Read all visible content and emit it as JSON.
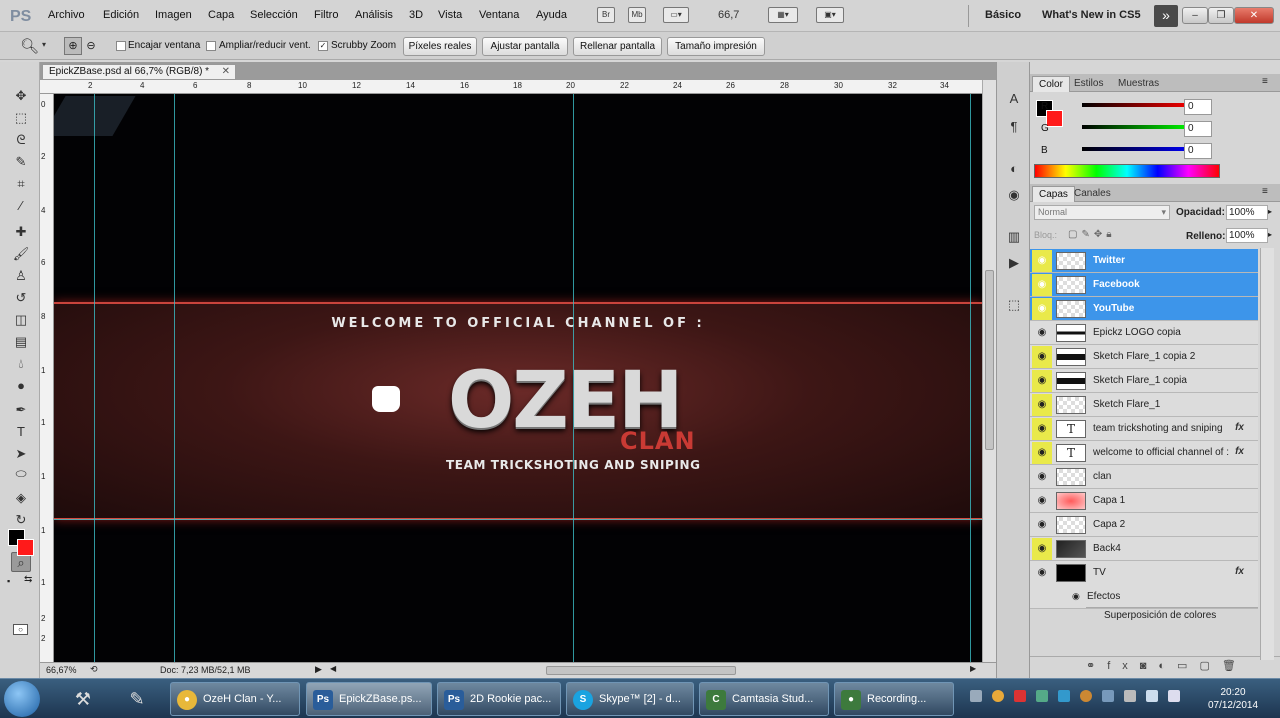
{
  "app": {
    "logo": "PS"
  },
  "menu": [
    "Archivo",
    "Edición",
    "Imagen",
    "Capa",
    "Selección",
    "Filtro",
    "Análisis",
    "3D",
    "Vista",
    "Ventana",
    "Ayuda"
  ],
  "menubar_icons": {
    "br": "Br",
    "mb": "Mb",
    "zoom": "66,7"
  },
  "workspace": {
    "basic": "Básico",
    "whats_new": "What's New in CS5"
  },
  "options": {
    "encajar": "Encajar ventana",
    "ampliar": "Ampliar/reducir vent.",
    "scrubby": "Scrubby Zoom",
    "scrubby_checked": true,
    "btn_pixeles": "Píxeles reales",
    "btn_ajustar": "Ajustar pantalla",
    "btn_rellenar": "Rellenar pantalla",
    "btn_tamano": "Tamaño impresión"
  },
  "document": {
    "tab_title": "EpickZBase.psd al 66,7% (RGB/8) *",
    "ruler_top": [
      "2",
      "4",
      "6",
      "8",
      "10",
      "12",
      "14",
      "16",
      "18",
      "20",
      "22",
      "24",
      "26",
      "28",
      "30",
      "32",
      "34"
    ],
    "ruler_left": [
      "0",
      "2",
      "4",
      "6",
      "8",
      "1",
      "1",
      "1",
      "1",
      "1",
      "2",
      "2"
    ],
    "canvas": {
      "welcome": "WELCOME TO OFFICIAL CHANNEL OF :",
      "title": "OZEH",
      "subtitle": "CLAN",
      "tagline": "TEAM TRICKSHOTING AND SNIPING"
    },
    "status_zoom": "66,67%",
    "status_doc": "Doc: 7,23 MB/52,1 MB"
  },
  "color_panel": {
    "tabs": [
      "Color",
      "Estilos",
      "Muestras"
    ],
    "r_label": "R",
    "g_label": "G",
    "b_label": "B",
    "r": "0",
    "g": "0",
    "b": "0"
  },
  "layers_panel": {
    "tabs": [
      "Capas",
      "Canales"
    ],
    "blend_mode": "Normal",
    "opacity_label": "Opacidad:",
    "opacity": "100%",
    "lock_label": "Bloq.:",
    "fill_label": "Relleno:",
    "fill": "100%",
    "layers": [
      {
        "name": "Twitter",
        "selected": true,
        "eye": "yellow",
        "thumb": "checker"
      },
      {
        "name": "Facebook",
        "selected": true,
        "eye": "yellow",
        "thumb": "checker"
      },
      {
        "name": "YouTube",
        "selected": true,
        "eye": "yellow",
        "thumb": "checker"
      },
      {
        "name": "Epickz LOGO copia",
        "eye": "gray",
        "thumb": "bar"
      },
      {
        "name": "Sketch Flare_1 copia 2",
        "eye": "yellow",
        "thumb": "bar"
      },
      {
        "name": "Sketch Flare_1 copia",
        "eye": "yellow",
        "thumb": "bar"
      },
      {
        "name": "Sketch Flare_1",
        "eye": "yellow",
        "thumb": "checker"
      },
      {
        "name": "team trickshoting and sniping",
        "eye": "yellow",
        "thumb": "text",
        "fx": "fx"
      },
      {
        "name": "welcome to official channel of :",
        "eye": "yellow",
        "thumb": "text",
        "fx": "fx"
      },
      {
        "name": "clan",
        "eye": "gray",
        "thumb": "checker"
      },
      {
        "name": "Capa 1",
        "eye": "gray",
        "thumb": "red"
      },
      {
        "name": "Capa 2",
        "eye": "gray",
        "thumb": "checker"
      },
      {
        "name": "Back4",
        "eye": "yellow",
        "thumb": "dark"
      },
      {
        "name": "TV",
        "eye": "gray",
        "thumb": "black",
        "fx": "fx"
      }
    ],
    "effects_label": "Efectos",
    "effect_item": "Superposición de colores"
  },
  "taskbar": {
    "items": [
      {
        "label": "OzeH Clan - Y...",
        "icon": "chrome-icon",
        "color": "#e8b83a"
      },
      {
        "label": "EpickZBase.ps...",
        "icon": "photoshop-icon",
        "color": "#2a5d9a"
      },
      {
        "label": "2D Rookie pac...",
        "icon": "photoshop-icon",
        "color": "#2a5d9a"
      },
      {
        "label": "Skype™ [2] - d...",
        "icon": "skype-icon",
        "color": "#1aa3e0"
      },
      {
        "label": "Camtasia Stud...",
        "icon": "camtasia-icon",
        "color": "#3d7a3d"
      },
      {
        "label": "Recording...",
        "icon": "recording-icon",
        "color": "#3d7a3d"
      }
    ],
    "time": "20:20",
    "date": "07/12/2014"
  }
}
